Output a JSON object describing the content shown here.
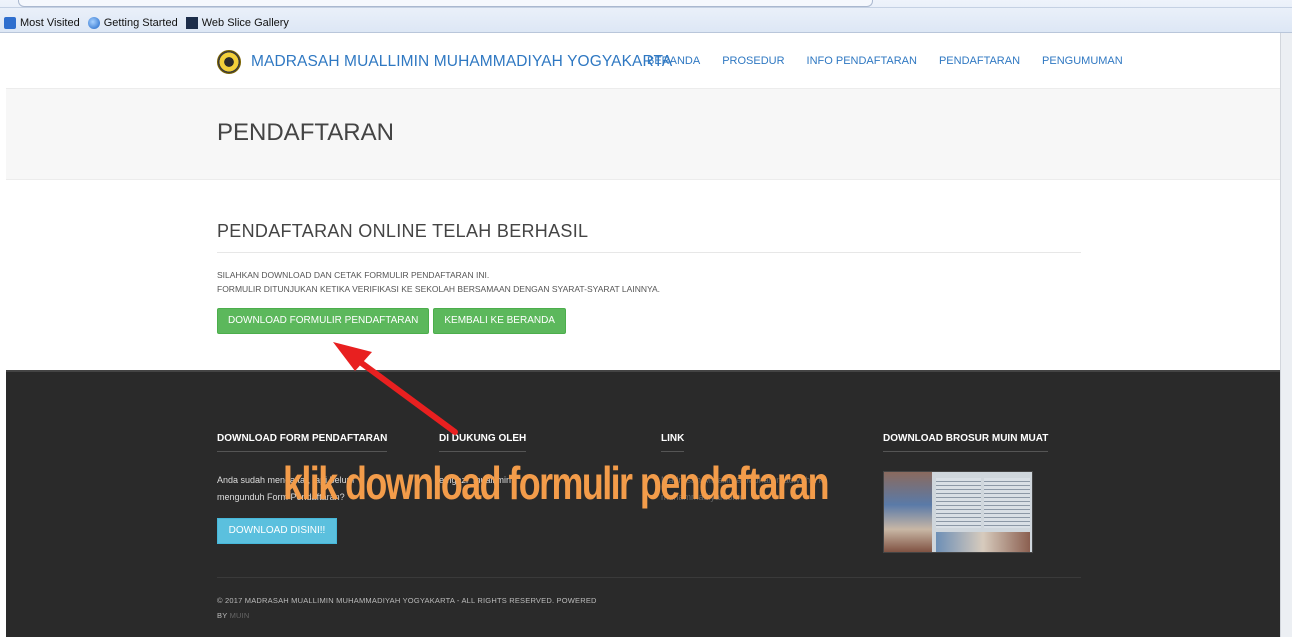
{
  "browser": {
    "bookmarks": [
      {
        "label": "Most Visited",
        "icon": "most-visited-icon"
      },
      {
        "label": "Getting Started",
        "icon": "firefox-icon"
      },
      {
        "label": "Web Slice Gallery",
        "icon": "web-slice-icon"
      }
    ]
  },
  "header": {
    "brand": "MADRASAH MUALLIMIN MUHAMMADIYAH YOGYAKARTA",
    "nav": [
      "BERANDA",
      "PROSEDUR",
      "INFO PENDAFTARAN",
      "PENDAFTARAN",
      "PENGUMUMAN"
    ]
  },
  "title_bar": {
    "title": "PENDAFTARAN"
  },
  "content": {
    "heading": "PENDAFTARAN ONLINE TELAH BERHASIL",
    "line1": "SILAHKAN DOWNLOAD DAN CETAK FORMULIR PENDAFTARAN INI.",
    "line2": "FORMULIR DITUNJUKAN KETIKA VERIFIKASI KE SEKOLAH BERSAMAAN DENGAN SYARAT-SYARAT LAINNYA.",
    "download_button": "DOWNLOAD FORMULIR PENDAFTARAN",
    "back_button": "KEMBALI KE BERANDA",
    "button_color": "#5cb85c"
  },
  "footer": {
    "col1": {
      "title": "DOWNLOAD FORM PENDAFTARAN",
      "text1": "Anda sudah mendaftar, tapi belum",
      "text2": "mengunduh Form Pendaftaran?",
      "button": "DOWNLOAD DISINI!!"
    },
    "col2": {
      "title": "DI DUKUNG OLEH",
      "text": "emgazi_muallimin"
    },
    "col3": {
      "title": "LINK",
      "links": [
        "Madrasah Mu'allimat Muhammadiyah Yk",
        "muhammadiyah.or.id"
      ]
    },
    "col4": {
      "title": "DOWNLOAD BROSUR MUIN MUAT"
    },
    "copyright1": "© 2017 MADRASAH MUALLIMIN MUHAMMADIYAH YOGYAKARTA - ALL RIGHTS RESERVED. POWERED",
    "copyright2": "BY",
    "powered_by": "MUIN"
  },
  "annotation": {
    "text": "klik download formulir pendaftaran",
    "arrow_color": "#e82020",
    "text_color": "#f39c4a"
  }
}
